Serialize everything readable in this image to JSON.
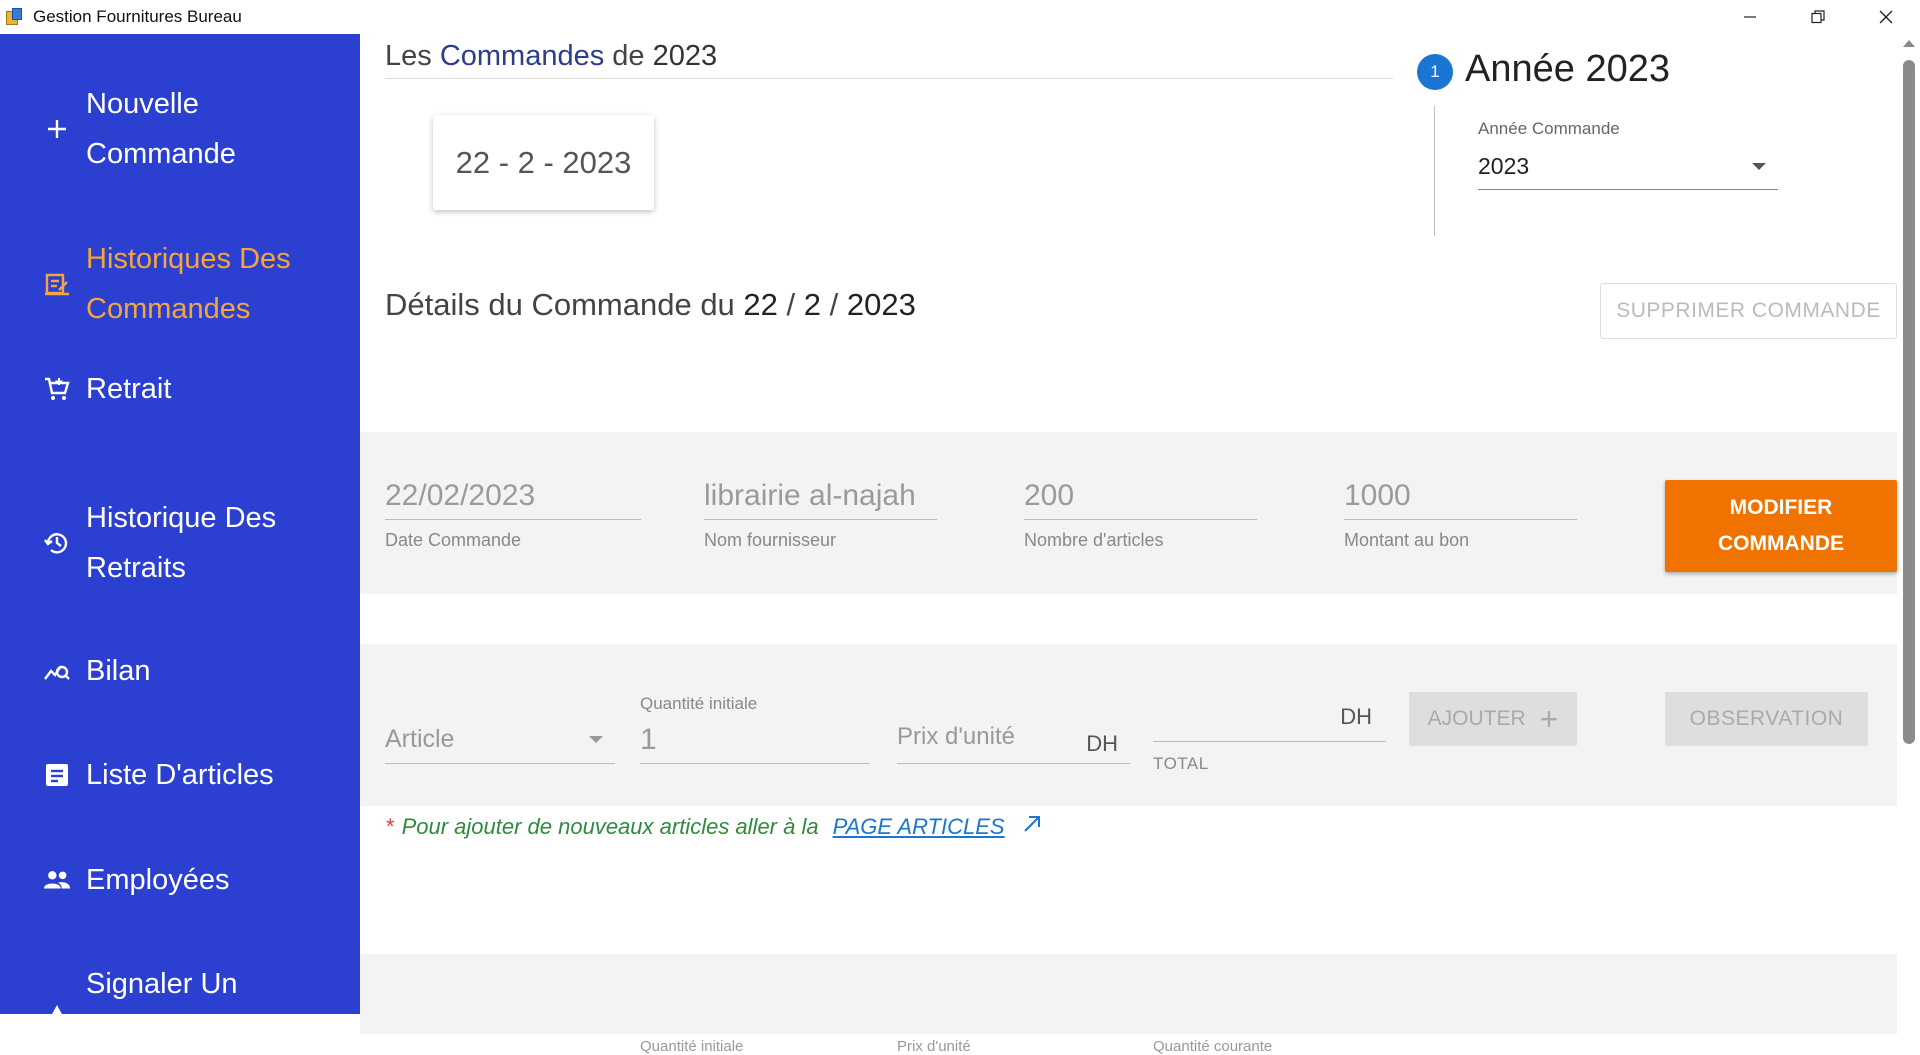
{
  "window": {
    "title": "Gestion Fournitures Bureau"
  },
  "sidebar": {
    "items": [
      {
        "label": "Nouvelle Commande",
        "icon": "plus-icon"
      },
      {
        "label": "Historiques Des Commandes",
        "icon": "history-list-icon",
        "active": true
      },
      {
        "label": "Retrait",
        "icon": "cart-icon"
      },
      {
        "label": "Historique Des Retraits",
        "icon": "history-icon"
      },
      {
        "label": "Bilan",
        "icon": "chart-search-icon"
      },
      {
        "label": "Liste D'articles",
        "icon": "article-list-icon"
      },
      {
        "label": "Employées",
        "icon": "people-icon"
      },
      {
        "label": "Signaler Un",
        "icon": "warning-icon"
      }
    ],
    "active_color": "#f6a53a",
    "bg_color": "#2b40d0"
  },
  "header": {
    "prefix": "Les",
    "highlight": "Commandes",
    "middle": "de",
    "year": "2023"
  },
  "date_card": {
    "text": "22 - 2 - 2023"
  },
  "year_stepper": {
    "step_number": "1",
    "title": "Année 2023",
    "field_label": "Année Commande",
    "selected": "2023"
  },
  "details": {
    "prefix": "Détails du Commande du",
    "day": "22",
    "sep1": "/",
    "month": "2",
    "sep2": "/",
    "year": "2023"
  },
  "delete_button": {
    "label": "SUPPRIMER COMMANDE"
  },
  "order_info": {
    "date": {
      "value": "22/02/2023",
      "label": "Date Commande"
    },
    "supplier": {
      "value": "librairie al-najah",
      "label": "Nom fournisseur"
    },
    "count": {
      "value": "200",
      "label": "Nombre d'articles"
    },
    "amount": {
      "value": "1000",
      "label": "Montant au bon"
    },
    "modify_button": {
      "line1": "MODIFIER",
      "line2": "COMMANDE"
    },
    "accent_color": "#f07300"
  },
  "add_article": {
    "article_placeholder": "Article",
    "qty_label": "Quantité initiale",
    "qty_value": "1",
    "price_placeholder": "Prix d'unité",
    "price_currency": "DH",
    "total_currency": "DH",
    "total_label": "TOTAL",
    "add_button": "AJOUTER",
    "observation_button": "OBSERVATION"
  },
  "note": {
    "star": "*",
    "text": "Pour ajouter de nouveaux articles aller à la",
    "link": "PAGE ARTICLES"
  },
  "bottom_row": {
    "qty_label": "Quantité initiale",
    "price_label": "Prix d'unité",
    "current_label": "Quantité courante"
  }
}
